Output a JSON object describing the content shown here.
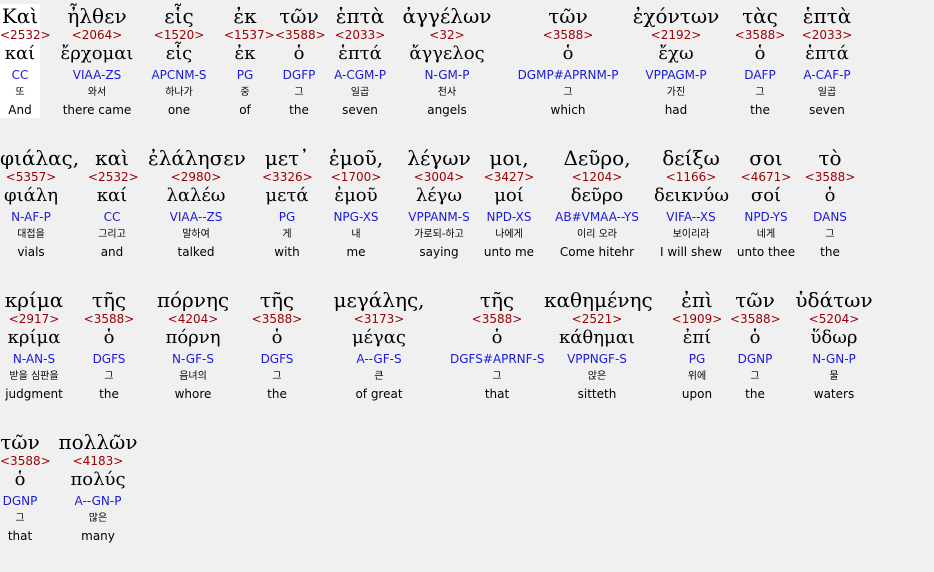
{
  "rows": [
    [
      {
        "greek": "Καὶ",
        "strong": "<2532>",
        "lemma": "καί",
        "parse": "CC",
        "korean": "또",
        "english": "And"
      },
      {
        "greek": "ἦλθεν",
        "strong": "<2064>",
        "lemma": "ἔρχομαι",
        "parse": "VIAA-ZS",
        "korean": "와서",
        "english": "there came"
      },
      {
        "greek": "εἷς",
        "strong": "<1520>",
        "lemma": "εἷς",
        "parse": "APCNM-S",
        "korean": "하나가",
        "english": "one"
      },
      {
        "greek": "ἐκ",
        "strong": "<1537>",
        "lemma": "ἐκ",
        "parse": "PG",
        "korean": "중",
        "english": "of"
      },
      {
        "greek": "τῶν",
        "strong": "<3588>",
        "lemma": "ὁ",
        "parse": "DGFP",
        "korean": "그",
        "english": "the"
      },
      {
        "greek": "ἑπτὰ",
        "strong": "<2033>",
        "lemma": "ἑπτά",
        "parse": "A-CGM-P",
        "korean": "일곱",
        "english": "seven"
      },
      {
        "greek": "ἀγγέλων",
        "strong": "<32>",
        "lemma": "ἄγγελος",
        "parse": "N-GM-P",
        "korean": "천사",
        "english": "angels"
      },
      {
        "greek": "τῶν",
        "strong": "<3588>",
        "lemma": "ὁ",
        "parse": "DGMP#APRNM-P",
        "korean": "그",
        "english": "which"
      },
      {
        "greek": "ἐχόντων",
        "strong": "<2192>",
        "lemma": "ἔχω",
        "parse": "VPPAGM-P",
        "korean": "가진",
        "english": "had"
      },
      {
        "greek": "τὰς",
        "strong": "<3588>",
        "lemma": "ὁ",
        "parse": "DAFP",
        "korean": "그",
        "english": "the"
      },
      {
        "greek": "ἑπτὰ",
        "strong": "<2033>",
        "lemma": "ἑπτά",
        "parse": "A-CAF-P",
        "korean": "일곱",
        "english": "seven"
      }
    ],
    [
      {
        "greek": "φιάλας,",
        "strong": "<5357>",
        "lemma": "φιάλη",
        "parse": "N-AF-P",
        "korean": "대접을",
        "english": "vials"
      },
      {
        "greek": "καὶ",
        "strong": "<2532>",
        "lemma": "καί",
        "parse": "CC",
        "korean": "그리고",
        "english": "and"
      },
      {
        "greek": "ἐλάλησεν",
        "strong": "<2980>",
        "lemma": "λαλέω",
        "parse": "VIAA--ZS",
        "korean": "말하여",
        "english": "talked"
      },
      {
        "greek": "μετ᾽",
        "strong": "<3326>",
        "lemma": "μετά",
        "parse": "PG",
        "korean": "게",
        "english": "with"
      },
      {
        "greek": "ἐμοῦ,",
        "strong": "<1700>",
        "lemma": "ἐμοῦ",
        "parse": "NPG-XS",
        "korean": "내",
        "english": "me"
      },
      {
        "greek": "λέγων",
        "strong": "<3004>",
        "lemma": "λέγω",
        "parse": "VPPANM-S",
        "korean": "가로되-하고",
        "english": "saying"
      },
      {
        "greek": "μοι,",
        "strong": "<3427>",
        "lemma": "μοί",
        "parse": "NPD-XS",
        "korean": "나에게",
        "english": "unto me"
      },
      {
        "greek": "Δεῦρο,",
        "strong": "<1204>",
        "lemma": "δεῦρο",
        "parse": "AB#VMAA--YS",
        "korean": "이리 오라",
        "english": "Come hitehr"
      },
      {
        "greek": "δείξω",
        "strong": "<1166>",
        "lemma": "δεικνύω",
        "parse": "VIFA--XS",
        "korean": "보이리라",
        "english": "I will shew"
      },
      {
        "greek": "σοι",
        "strong": "<4671>",
        "lemma": "σοί",
        "parse": "NPD-YS",
        "korean": "네게",
        "english": "unto thee"
      },
      {
        "greek": "τὸ",
        "strong": "<3588>",
        "lemma": "ὁ",
        "parse": "DANS",
        "korean": "그",
        "english": "the"
      }
    ],
    [
      {
        "greek": "κρίμα",
        "strong": "<2917>",
        "lemma": "κρίμα",
        "parse": "N-AN-S",
        "korean": "받을 심판을",
        "english": "judgment"
      },
      {
        "greek": "τῆς",
        "strong": "<3588>",
        "lemma": "ὁ",
        "parse": "DGFS",
        "korean": "그",
        "english": "the"
      },
      {
        "greek": "πόρνης",
        "strong": "<4204>",
        "lemma": "πόρνη",
        "parse": "N-GF-S",
        "korean": "음녀의",
        "english": "whore"
      },
      {
        "greek": "τῆς",
        "strong": "<3588>",
        "lemma": "ὁ",
        "parse": "DGFS",
        "korean": "그",
        "english": "the"
      },
      {
        "greek": "μεγάλης,",
        "strong": "<3173>",
        "lemma": "μέγας",
        "parse": "A--GF-S",
        "korean": "큰",
        "english": "of great"
      },
      {
        "greek": "τῆς",
        "strong": "<3588>",
        "lemma": "ὁ",
        "parse": "DGFS#APRNF-S",
        "korean": "그",
        "english": "that"
      },
      {
        "greek": "καθημένης",
        "strong": "<2521>",
        "lemma": "κάθημαι",
        "parse": "VPPNGF-S",
        "korean": "앉은",
        "english": "sitteth"
      },
      {
        "greek": "ἐπὶ",
        "strong": "<1909>",
        "lemma": "ἐπί",
        "parse": "PG",
        "korean": "위에",
        "english": "upon"
      },
      {
        "greek": "τῶν",
        "strong": "<3588>",
        "lemma": "ὁ",
        "parse": "DGNP",
        "korean": "그",
        "english": "the"
      },
      {
        "greek": "ὑδάτων",
        "strong": "<5204>",
        "lemma": "ὕδωρ",
        "parse": "N-GN-P",
        "korean": "물",
        "english": "waters"
      }
    ],
    [
      {
        "greek": "τῶν",
        "strong": "<3588>",
        "lemma": "ὁ",
        "parse": "DGNP",
        "korean": "그",
        "english": "that"
      },
      {
        "greek": "πολλῶν",
        "strong": "<4183>",
        "lemma": "πολύς",
        "parse": "A--GN-P",
        "korean": "많은",
        "english": "many"
      }
    ]
  ]
}
